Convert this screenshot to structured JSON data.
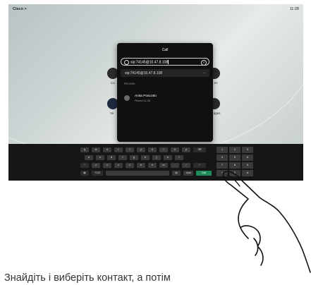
{
  "statusbar": {
    "brand": "Cisco",
    "chevron": ">",
    "clock": "11:28"
  },
  "side_labels": [
    "Ca",
    "Ve",
    "...es",
    "...ages"
  ],
  "dialog": {
    "title": "Call",
    "search_value": "sip:74145@10.47.8.108",
    "suggestion": "sip:74145@10.47.8.108",
    "recents_label": "Recents",
    "contact_name": "Anita Poscotto",
    "contact_detail": "Placed 11:28"
  },
  "keyboard": {
    "row1": [
      "q",
      "w",
      "e",
      "r",
      "t",
      "y",
      "u",
      "i",
      "o",
      "p"
    ],
    "row2": [
      "a",
      "s",
      "d",
      "f",
      "g",
      "h",
      "j",
      "k",
      "l"
    ],
    "row3": [
      "z",
      "x",
      "c",
      "v",
      "b",
      "n",
      "m",
      ".",
      "/"
    ],
    "mode_key": "?123",
    "at_key": "@",
    "dot_key": ".com",
    "call_key": "Call",
    "numpad": [
      "1",
      "2",
      "3",
      "4",
      "5",
      "6",
      "7",
      "8",
      "9",
      "*",
      "0",
      "#"
    ]
  },
  "colors": {
    "call_green": "#1e8a58",
    "dialog_bg": "#101010"
  },
  "caption": "Знайдіть і виберіть контакт, а потім"
}
